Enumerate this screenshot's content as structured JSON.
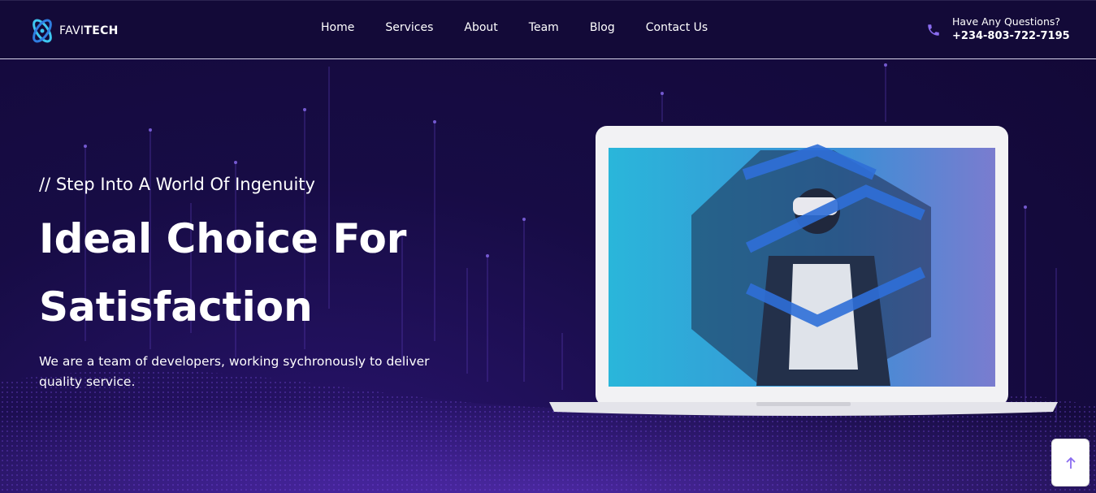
{
  "header": {
    "logo_text_light": "FAVI",
    "logo_text_bold": "TECH",
    "nav": [
      "Home",
      "Services",
      "About",
      "Team",
      "Blog",
      "Contact Us"
    ],
    "contact_label": "Have Any Questions?",
    "contact_phone": "+234-803-722-7195"
  },
  "hero": {
    "eyebrow": "// Step Into A World Of Ingenuity",
    "title_line1": "Ideal Choice For",
    "title_line2": "Satisfaction",
    "description": "We are a team of developers, working sychronously to deliver quality service."
  },
  "colors": {
    "background": "#130a38",
    "accent": "#8a6cf0",
    "laptop_screen": "#2fb3d9"
  },
  "icons": {
    "logo": "atom-logo-icon",
    "phone": "phone-icon",
    "scroll_top": "arrow-up-icon"
  }
}
